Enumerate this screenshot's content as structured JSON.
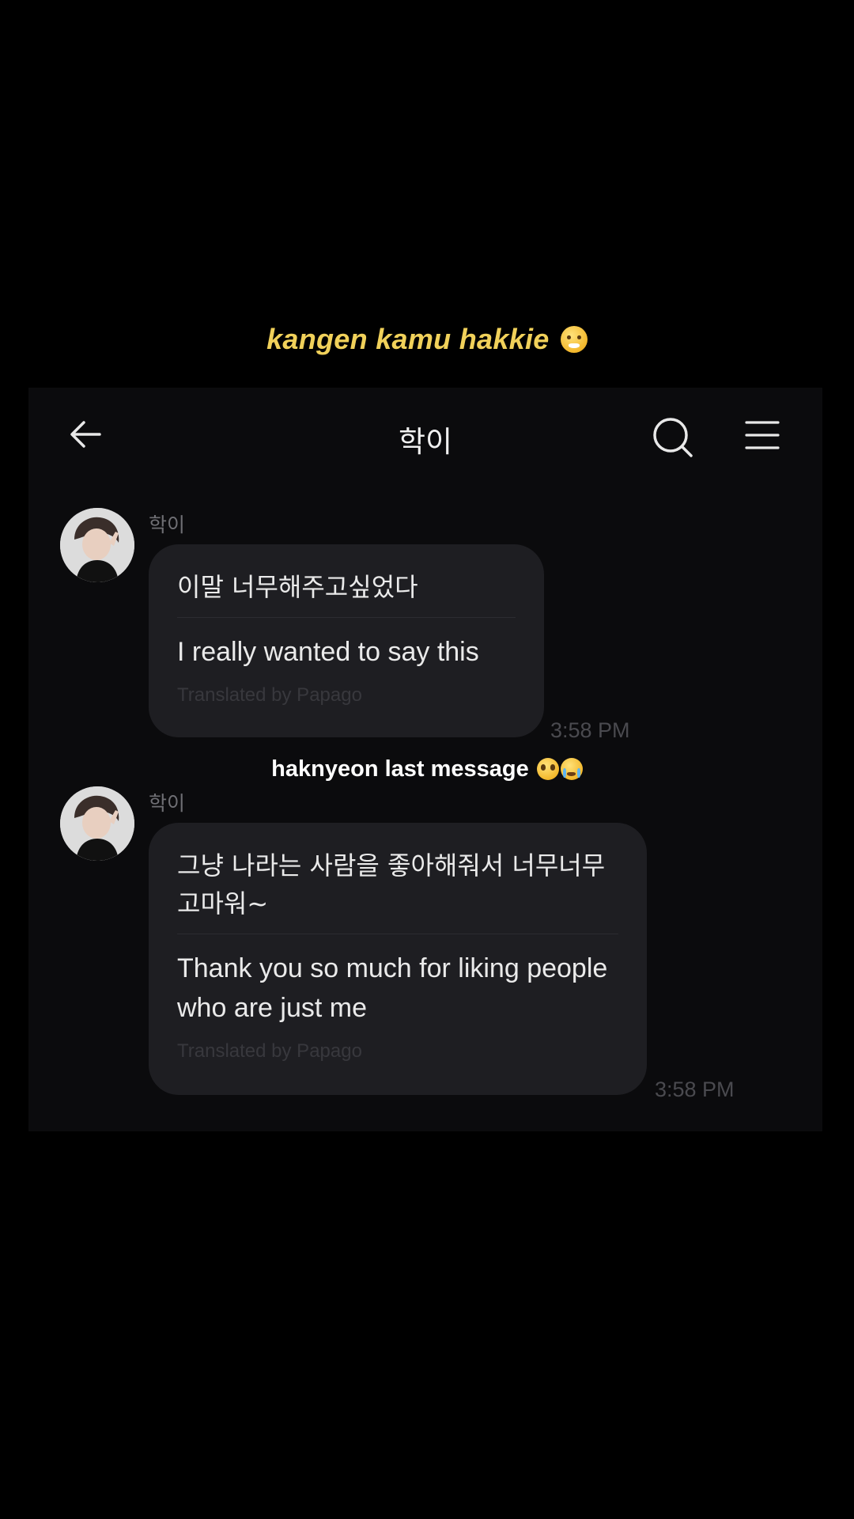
{
  "overlay": {
    "top_caption": "kangen kamu hakkie",
    "top_caption_emoji": "sneezing-face-emoji",
    "middle_caption": "haknyeon last message",
    "middle_caption_emojis": [
      "pleading-face-emoji",
      "loudly-crying-face-emoji"
    ],
    "top_caption_color": "#f1d15a"
  },
  "header": {
    "title": "학이",
    "back_icon": "arrow-left-icon",
    "search_icon": "search-icon",
    "menu_icon": "hamburger-menu-icon"
  },
  "messages": [
    {
      "sender": "학이",
      "original": "이말 너무해주고싶었다",
      "translation": "I really wanted to say this",
      "translated_by": "Translated by Papago",
      "time": "3:58 PM"
    },
    {
      "sender": "학이",
      "original": "그냥 나라는 사람을 좋아해줘서 너무너무 고마워~",
      "translation": "Thank you so much for liking people who are just me",
      "translated_by": "Translated by Papago",
      "time": "3:58 PM"
    }
  ],
  "colors": {
    "background": "#000000",
    "chat_background": "#0b0b0d",
    "bubble": "#1e1e22"
  }
}
